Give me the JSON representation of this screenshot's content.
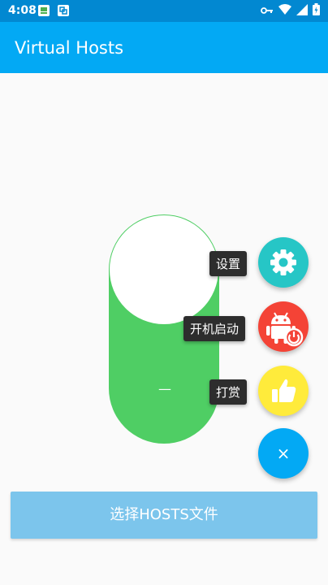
{
  "status_bar": {
    "time": "4:08",
    "notification_icons": [
      "app-notification-icon",
      "stack-notification-icon"
    ],
    "right_icons": [
      "vpn-key-icon",
      "wifi-icon",
      "signal-icon",
      "battery-icon"
    ]
  },
  "app_bar": {
    "title": "Virtual Hosts",
    "color": "#03a9f4"
  },
  "switch": {
    "state": "on",
    "off_mark": "—",
    "track_color": "#4fce64"
  },
  "fab_menu": {
    "items": [
      {
        "label": "设置",
        "icon": "gear-icon",
        "color": "#26c6c6"
      },
      {
        "label": "开机启动",
        "icon": "android-power-icon",
        "color": "#f44336"
      },
      {
        "label": "打赏",
        "icon": "thumbs-up-icon",
        "color": "#ffeb3b"
      }
    ],
    "main_icon": "close-icon",
    "main_symbol": "×",
    "main_color": "#03a9f4"
  },
  "select_button": {
    "label": "选择HOSTS文件"
  }
}
